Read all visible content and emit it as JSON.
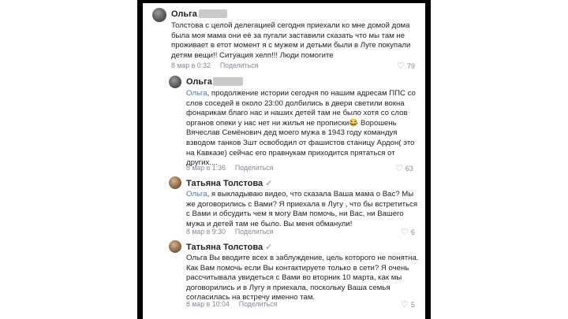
{
  "comments": [
    {
      "author": "Ольга",
      "mention": "",
      "text": "Толстова с целой делегацией сегодня приехали ко мне домой дома была моя мама они её за пугали заставили сказать что мы там не проживает в етот момент я с мужем и детьми были в Луге покупали детям вещи!! Ситуация хелп!!! Люди помогите",
      "date": "8 мар в 0:32",
      "share": "Поделиться",
      "likes": "79"
    },
    {
      "author": "Ольга",
      "mention": "Ольга",
      "text": ", продолжение истории сегодня по нашим адресам ППС со слов соседей в около 23:00 долбились в двери светили вокна фонарикам благо нас и наших детей там не было хотя со слов органов опеки у нас нет ни жилья не прописки😂 Ворошень Вячеслав Семёнович дед моего мужа в 1943 году командуя взводом танков Зшт освободил от фашистов станицу Ардон( это на Кавказе) сейчас его правнукам приходится прятаться от других....",
      "date": "8 мар в 1:36",
      "share": "Поделиться",
      "likes": "63"
    },
    {
      "author": "Татьяна Толстова",
      "mention": "Ольга",
      "text": ", я выкладываю видео, что сказала Ваша мама о Вас? Мы же договорились с Вами? Я приехала в Лугу , что бы встретиться с Вами и обсудить чем я могу Вам помочь, ни Вас, ни Вашего мужа и детей там не было. Вы меня обманули!",
      "date": "8 мар в 9:30",
      "share": "Поделиться",
      "likes": "6"
    },
    {
      "author": "Татьяна Толстова",
      "mention": "",
      "text": "Ольга Вы вводите всех в заблуждение, цель которого не понятна. Как Вам помочь если Вы контактируете только в сети? Я очень рассчитывала увидеться с Вами во вторник 10 марта, как мы договорились и в Лугу я приехала, поскольку Ваша семья согласилась на встречу именно там.",
      "date": "8 мар в 10:04",
      "share": "Поделиться",
      "likes": "5"
    }
  ],
  "verified_mark": "✓",
  "icons": {
    "like": "heart-icon",
    "avatar": "avatar"
  },
  "colors": {
    "mention": "#4a76a8",
    "meta": "#818c99",
    "frame": "#000000"
  }
}
